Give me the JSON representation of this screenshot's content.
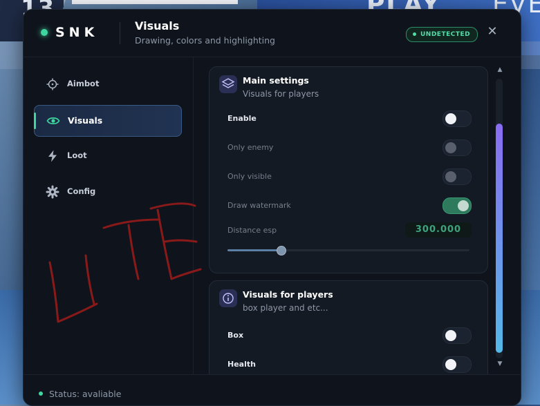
{
  "background": {
    "badge_number": "13",
    "right_text_1": "PLAY",
    "right_text_2": "EVE"
  },
  "header": {
    "logo": "SNK",
    "title": "Visuals",
    "subtitle": "Drawing, colors and highlighting",
    "badge": "UNDETECTED",
    "close_glyph": "✕"
  },
  "sidebar": {
    "items": [
      {
        "label": "Aimbot",
        "icon": "crosshair-icon"
      },
      {
        "label": "Visuals",
        "icon": "eye-icon"
      },
      {
        "label": "Loot",
        "icon": "bolt-icon"
      },
      {
        "label": "Config",
        "icon": "gear-icon"
      }
    ],
    "active": "Visuals"
  },
  "main_settings": {
    "title": "Main settings",
    "subtitle": "Visuals for players",
    "icon": "layers-icon",
    "enable": {
      "label": "Enable",
      "on": false
    },
    "only_enemy": {
      "label": "Only enemy",
      "on": false,
      "disabled": true
    },
    "only_visible": {
      "label": "Only visible",
      "on": false,
      "disabled": true
    },
    "draw_watermark": {
      "label": "Draw watermark",
      "on": true
    },
    "distance_esp": {
      "label": "Distance esp",
      "value": "300.000",
      "fraction": 0.22
    }
  },
  "visuals_for_players": {
    "title": "Visuals for players",
    "subtitle": "box player and etc...",
    "icon": "info-icon",
    "box": {
      "label": "Box",
      "on": false
    },
    "health": {
      "label": "Health",
      "on": false
    }
  },
  "scrollbar": {
    "thumb_start": 0.16,
    "thumb_end": 0.98
  },
  "footer": {
    "status": "Status: avaliable"
  },
  "overlay": {
    "text": "LITE"
  },
  "colors": {
    "accent_green": "#3fd7a0",
    "scroll_gradient_top": "#8a6cf0",
    "scroll_gradient_bottom": "#54b8e8",
    "overlay_ink": "#8a1a1a"
  }
}
